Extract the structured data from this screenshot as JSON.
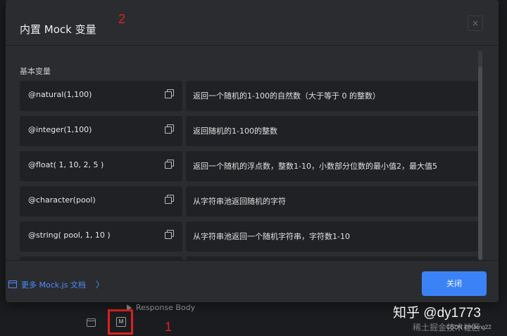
{
  "modal": {
    "title": "内置 Mock 变量",
    "close_icon": "×",
    "section_title": "基本变量",
    "variables": [
      {
        "code": "@natural(1,100)",
        "description": "返回一个随机的1-100的自然数（大于等于 0 的整数）"
      },
      {
        "code": "@integer(1,100)",
        "description": "返回随机的1-100的整数"
      },
      {
        "code": "@float( 1, 10, 2, 5 )",
        "description": "返回一个随机的浮点数，整数1-10，小数部分位数的最小值2，最大值5"
      },
      {
        "code": "@character(pool)",
        "description": "从字符串池返回随机的字符"
      },
      {
        "code": "@string( pool, 1, 10 )",
        "description": "从字符串池返回一个随机字符串，字符数1-10"
      }
    ],
    "footer": {
      "docs_link": "更多 Mock.js 文档",
      "docs_chevron": "〉",
      "close_button": "关闭"
    }
  },
  "background": {
    "response_body": "Response Body",
    "mock_icon_letter": "M"
  },
  "annotations": {
    "one": "1",
    "two": "2"
  },
  "watermark": {
    "main": "知乎 @dy1773",
    "sub": "稀土掘金技术社区",
    "csdn": "CSDN @Kiking22"
  },
  "colors": {
    "accent": "#3b82f6",
    "annotation_red": "#e0211d",
    "link": "#4d8dff"
  },
  "icons": [
    "close-icon",
    "copy-icon",
    "doc-icon",
    "chevron-right-icon",
    "panel-icon",
    "mock-icon",
    "play-triangle-icon"
  ]
}
